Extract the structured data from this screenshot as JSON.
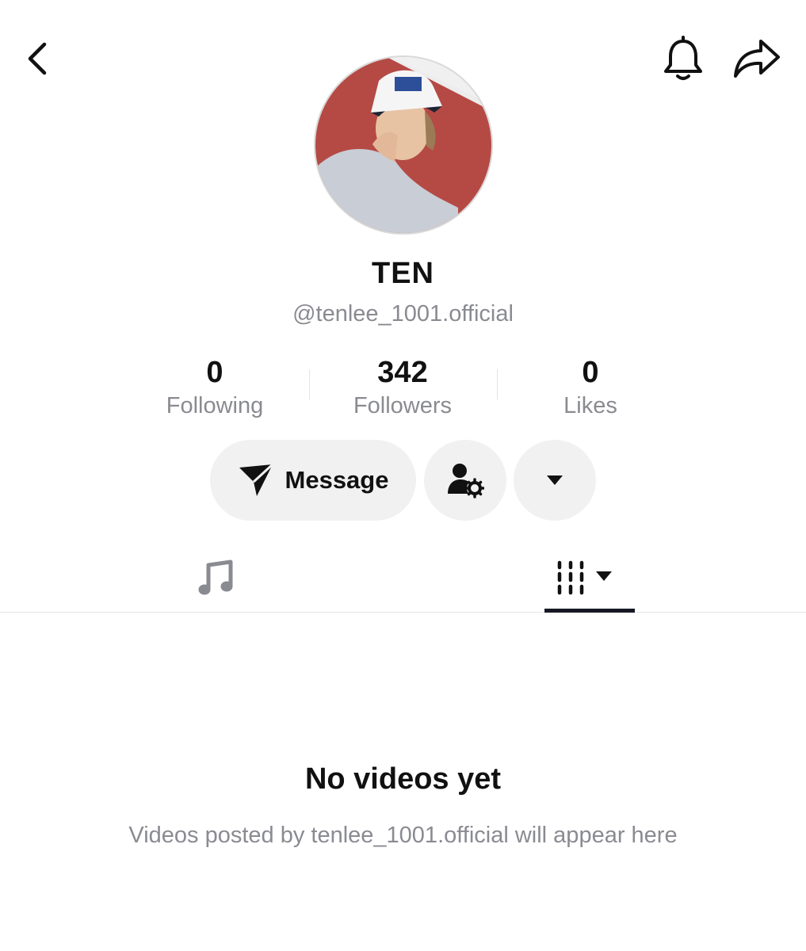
{
  "header": {
    "back_icon": "chevron-left-icon",
    "notification_icon": "bell-icon",
    "share_icon": "share-arrow-icon"
  },
  "profile": {
    "display_name": "TEN",
    "username": "@tenlee_1001.official",
    "avatar_icon": "profile-photo"
  },
  "stats": [
    {
      "value": "0",
      "label": "Following"
    },
    {
      "value": "342",
      "label": "Followers"
    },
    {
      "value": "0",
      "label": "Likes"
    }
  ],
  "actions": {
    "message_label": "Message",
    "message_icon": "send-icon",
    "profile_settings_icon": "user-gear-icon",
    "more_icon": "caret-down-icon"
  },
  "tabs": [
    {
      "icon": "music-note-icon",
      "active": false
    },
    {
      "icon": "video-grid-icon",
      "active": true
    }
  ],
  "empty_state": {
    "title": "No videos yet",
    "subtitle": "Videos posted by tenlee_1001.official will appear here"
  },
  "colors": {
    "primary_text": "#161823",
    "secondary_text": "#8a8b91",
    "button_bg": "#f1f1f2",
    "divider": "#e6e6e8"
  }
}
